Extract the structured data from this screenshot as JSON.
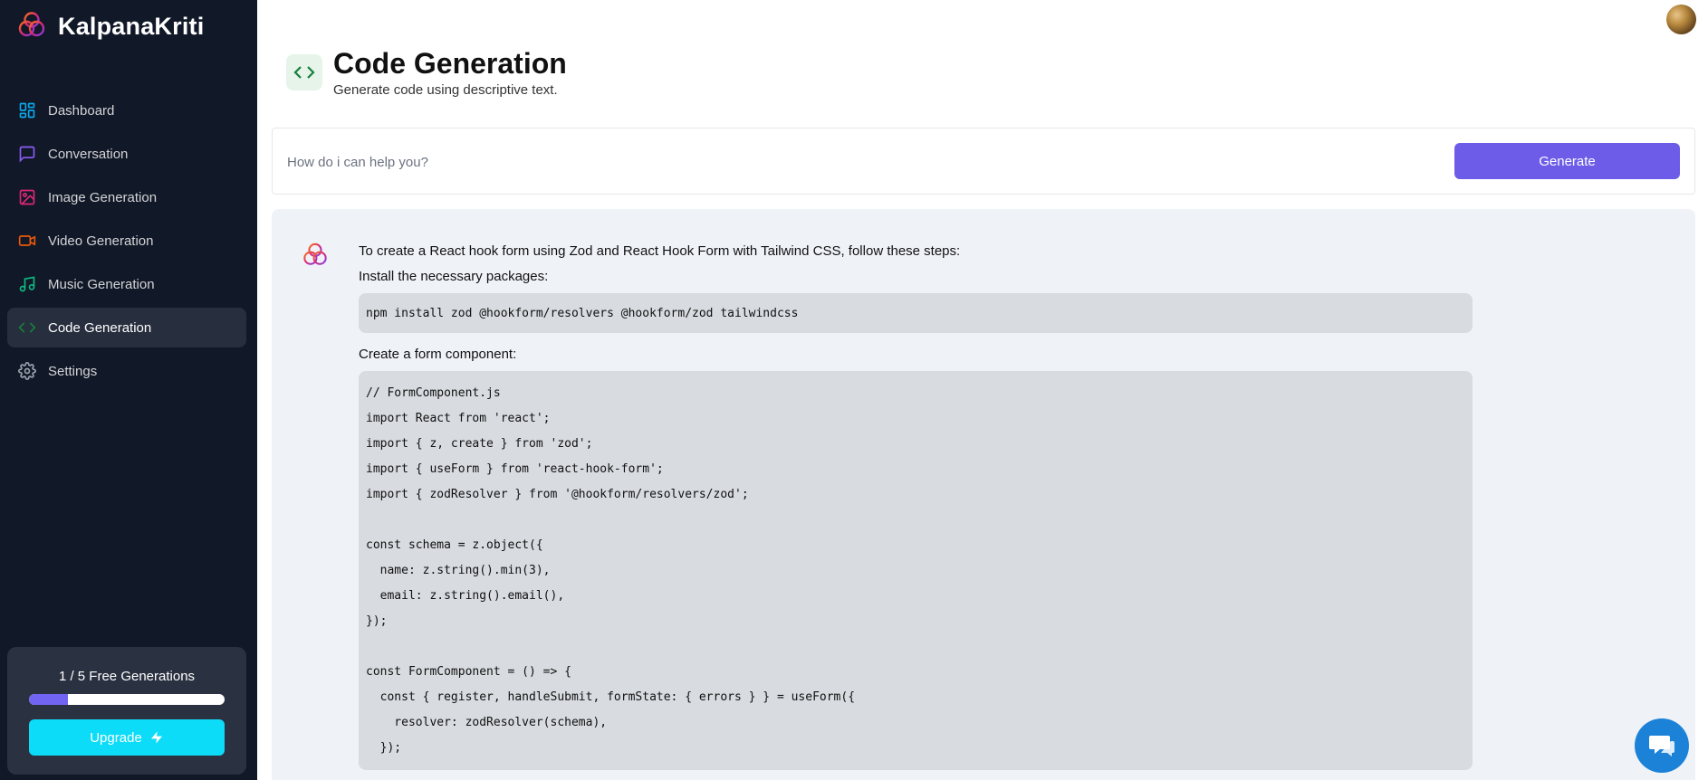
{
  "brand": {
    "name": "KalpanaKriti"
  },
  "sidebar": {
    "items": [
      {
        "label": "Dashboard",
        "icon": "dashboard-icon",
        "color": "#0ea5e9"
      },
      {
        "label": "Conversation",
        "icon": "message-square-icon",
        "color": "#8b5cf6"
      },
      {
        "label": "Image Generation",
        "icon": "image-icon",
        "color": "#db2777"
      },
      {
        "label": "Video Generation",
        "icon": "video-icon",
        "color": "#ea580c"
      },
      {
        "label": "Music Generation",
        "icon": "music-icon",
        "color": "#10b981"
      },
      {
        "label": "Code Generation",
        "icon": "code-icon",
        "color": "#15803d"
      },
      {
        "label": "Settings",
        "icon": "settings-icon",
        "color": "#9ca3af"
      }
    ],
    "active": "Code Generation"
  },
  "usage": {
    "label": "1 / 5 Free Generations",
    "used": 1,
    "limit": 5,
    "upgrade_label": "Upgrade"
  },
  "header": {
    "title": "Code Generation",
    "subtitle": "Generate code using descriptive text."
  },
  "prompt": {
    "placeholder": "How do i can help you?",
    "value": "",
    "generate_label": "Generate"
  },
  "response": {
    "intro": "To create a React hook form using Zod and React Hook Form with Tailwind CSS, follow these steps:",
    "step1": "Install the necessary packages:",
    "install_cmd": "npm install zod @hookform/resolvers @hookform/zod tailwindcss",
    "step2": "Create a form component:",
    "code_lines": [
      "// FormComponent.js",
      "import React from 'react';",
      "import { z, create } from 'zod';",
      "import { useForm } from 'react-hook-form';",
      "import { zodResolver } from '@hookform/resolvers/zod';",
      "",
      "const schema = z.object({",
      "  name: z.string().min(3),",
      "  email: z.string().email(),",
      "});",
      "",
      "const FormComponent = () => {",
      "  const { register, handleSubmit, formState: { errors } } = useForm({",
      "    resolver: zodResolver(schema),",
      "  });"
    ]
  },
  "colors": {
    "sidebar_bg": "#111827",
    "accent": "#6c5ce7",
    "upgrade": "#0ddcf8",
    "chat_button": "#1b82d8"
  }
}
